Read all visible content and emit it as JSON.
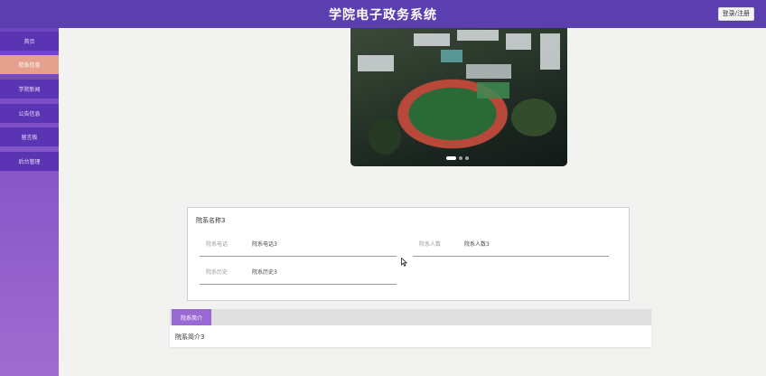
{
  "header": {
    "title": "学院电子政务系统",
    "login_label": "登录/注册"
  },
  "sidebar": {
    "items": [
      {
        "label": "首页"
      },
      {
        "label": "院系信息"
      },
      {
        "label": "学院新闻"
      },
      {
        "label": "公告信息"
      },
      {
        "label": "留言板"
      },
      {
        "label": "后台管理"
      }
    ],
    "active_index": 1
  },
  "carousel": {
    "slide_count": 3,
    "active_slide": 0
  },
  "department": {
    "name": "院系名称3",
    "phone_label": "院系电话",
    "phone_value": "院系电话3",
    "count_label": "院系人数",
    "count_value": "院系人数3",
    "history_label": "院系历史",
    "history_value": "院系历史3"
  },
  "tabs": {
    "items": [
      {
        "label": "院系简介"
      }
    ],
    "content": "院系简介3"
  },
  "colors": {
    "header_bg": "#5b3eb0",
    "sidebar_item": "#5a34b3",
    "sidebar_active": "#e5a18d",
    "tab_active": "#9a6ad4"
  }
}
